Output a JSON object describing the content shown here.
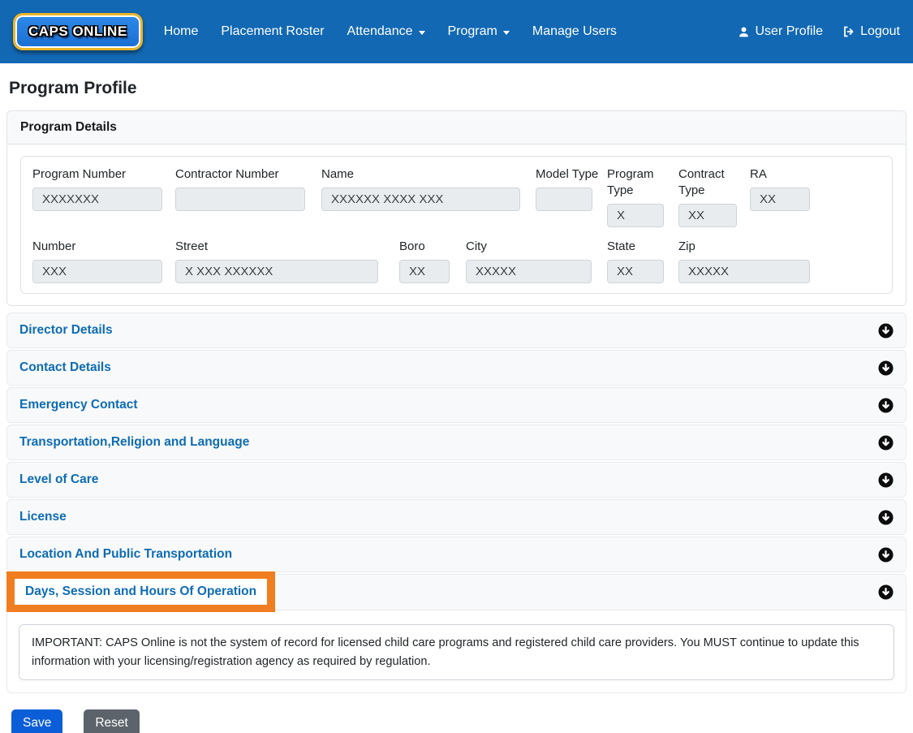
{
  "navbar": {
    "logo_text": "CAPS ONLINE",
    "items": [
      {
        "label": "Home"
      },
      {
        "label": "Placement Roster"
      },
      {
        "label": "Attendance",
        "has_dropdown": true
      },
      {
        "label": "Program",
        "has_dropdown": true
      },
      {
        "label": "Manage Users"
      }
    ],
    "user_profile_label": "User Profile",
    "logout_label": "Logout"
  },
  "page_title": "Program Profile",
  "program_details": {
    "title": "Program Details",
    "row1": [
      {
        "label": "Program Number",
        "value": "XXXXXXX"
      },
      {
        "label": "Contractor Number",
        "value": ""
      },
      {
        "label": "Name",
        "value": "XXXXXX XXXX XXX"
      },
      {
        "label": "Model Type",
        "value": ""
      },
      {
        "label": "Program Type",
        "value": "X"
      },
      {
        "label": "Contract Type",
        "value": "XX"
      },
      {
        "label": "RA",
        "value": "XX"
      }
    ],
    "row2": [
      {
        "label": "Number",
        "value": "XXX"
      },
      {
        "label": "Street",
        "value": "X XXX XXXXXX"
      },
      {
        "label": "Boro",
        "value": "XX"
      },
      {
        "label": "City",
        "value": "XXXXX"
      },
      {
        "label": "State",
        "value": "XX"
      },
      {
        "label": "Zip",
        "value": "XXXXX"
      }
    ]
  },
  "accordion": {
    "sections": [
      {
        "label": "Director Details"
      },
      {
        "label": "Contact Details"
      },
      {
        "label": "Emergency Contact"
      },
      {
        "label": "Transportation,Religion and Language"
      },
      {
        "label": "Level of Care"
      },
      {
        "label": "License"
      },
      {
        "label": "Location And Public Transportation"
      },
      {
        "label": "Days, Session and Hours Of Operation"
      }
    ],
    "highlighted_section": "Days, Session and Hours Of Operation"
  },
  "notice": {
    "text": "IMPORTANT: CAPS Online is not the system of record for licensed child care programs and registered child care providers. You MUST continue to update this information with your licensing/registration agency as required by regulation."
  },
  "actions": {
    "save_label": "Save",
    "reset_label": "Reset"
  },
  "colors": {
    "navbar_bg": "#1268b3",
    "accent_blue": "#0d6cb5",
    "highlight_orange": "#f07d1f",
    "save_bg": "#0b5ed7",
    "reset_bg": "#5c636a",
    "input_bg": "#e9ecef"
  }
}
